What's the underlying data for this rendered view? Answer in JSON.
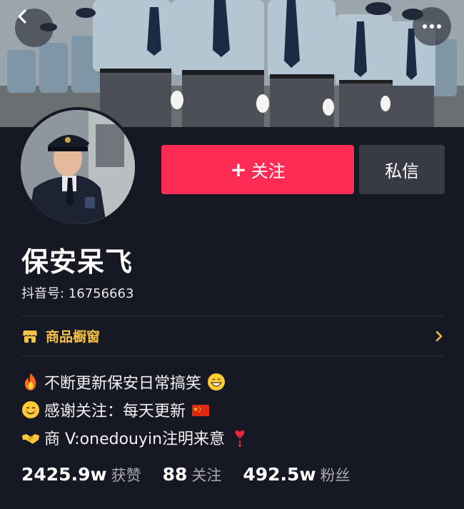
{
  "header": {
    "back_icon": "chevron-left-icon",
    "more_icon": "more-horizontal-icon"
  },
  "actions": {
    "follow_plus": "+",
    "follow_label": "关注",
    "message_label": "私信"
  },
  "profile": {
    "nickname": "保安呆飞",
    "douyin_id": "抖音号: 16756663"
  },
  "shop": {
    "label": "商品橱窗",
    "icon": "shop-window-icon",
    "arrow_icon": "chevron-right-icon"
  },
  "bio": {
    "lines": [
      {
        "emoji_before": "fire-emoji",
        "text": "不断更新保安日常搞笑",
        "emoji_after": "grinning-face-emoji"
      },
      {
        "emoji_before": "smiling-face-emoji",
        "text": "感谢关注：每天更新",
        "emoji_after": "china-flag-emoji"
      },
      {
        "emoji_before": "handshake-emoji",
        "text": "商 V:onedouyin注明来意",
        "emoji_after": "heart-exclamation-emoji"
      }
    ]
  },
  "stats": {
    "likes_value": "2425.9w",
    "likes_label": "获赞",
    "following_value": "88",
    "following_label": "关注",
    "followers_value": "492.5w",
    "followers_label": "粉丝"
  },
  "colors": {
    "background": "#161823",
    "follow_button": "#fe2c55",
    "message_button": "#393b44",
    "shop_accent": "#f6c244"
  }
}
